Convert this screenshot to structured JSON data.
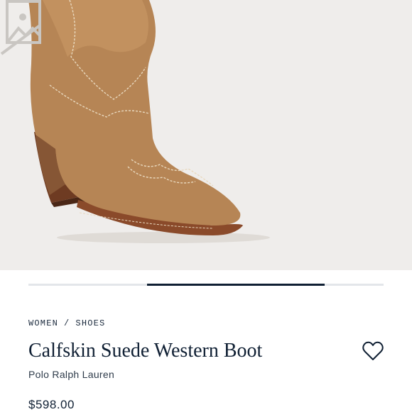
{
  "product": {
    "breadcrumb": [
      {
        "label": "WOMEN"
      },
      {
        "label": "SHOES"
      }
    ],
    "breadcrumb_separator": "/",
    "title": "Calfskin Suede Western Boot",
    "brand": "Polo Ralph Lauren",
    "price": "$598.00"
  },
  "carousel": {
    "current_slide_fraction_start": 0.334,
    "current_slide_fraction_width": 0.5
  },
  "icons": {
    "wishlist": "heart-outline-icon",
    "placeholder": "image-placeholder-icon"
  },
  "colors": {
    "hero_background": "#efedeb",
    "suede": "#b68555",
    "heel": "#6e3b22",
    "text_primary": "#0f1f33",
    "progress_active": "#0f1f33",
    "progress_track": "#e3e6ea"
  }
}
